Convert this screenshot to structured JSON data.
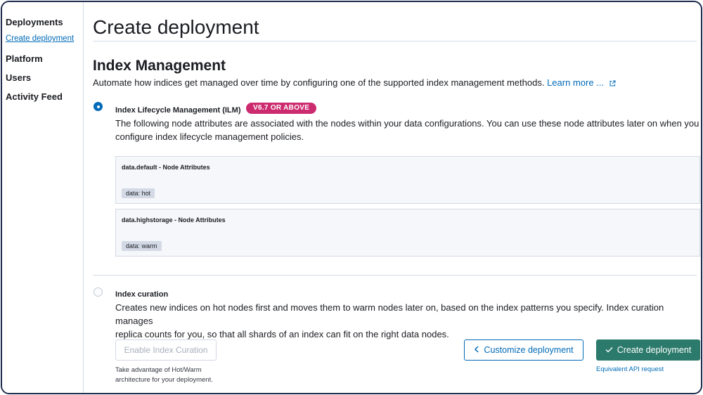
{
  "sidebar": {
    "items": [
      {
        "label": "Deployments"
      },
      {
        "label": "Create deployment"
      },
      {
        "label": "Platform"
      },
      {
        "label": "Users"
      },
      {
        "label": "Activity Feed"
      }
    ]
  },
  "page": {
    "title": "Create deployment"
  },
  "index_management": {
    "title": "Index Management",
    "description": "Automate how indices get managed over time by configuring one of the supported index management methods.",
    "learn_more": "Learn more ...",
    "ilm": {
      "label": "Index Lifecycle Management (ILM)",
      "badge": "V6.7 OR ABOVE",
      "selected": true,
      "description_line1": "The following node attributes are associated with the nodes within your data configurations. You can use these node attributes later on when you",
      "description_line2": "configure index lifecycle management policies.",
      "panels": [
        {
          "title": "data.default - Node Attributes",
          "tag": "data: hot"
        },
        {
          "title": "data.highstorage - Node Attributes",
          "tag": "data: warm"
        }
      ]
    },
    "curation": {
      "label": "Index curation",
      "selected": false,
      "description_line1": "Creates new indices on hot nodes first and moves them to warm nodes later on, based on the index patterns you specify. Index curation manages",
      "description_line2": "replica counts for you, so that all shards of an index can fit on the right data nodes.",
      "enable_button": "Enable Index Curation",
      "help_line1": "Take advantage of Hot/Warm",
      "help_line2": "architecture for your deployment."
    }
  },
  "footer": {
    "customize_button": "Customize deployment",
    "create_button": "Create deployment",
    "api_link": "Equivalent API request"
  },
  "colors": {
    "link": "#006bb8",
    "primary": "#2b7a6b",
    "badge": "#cc2b6f"
  },
  "icons": {
    "external_link": "external-link-icon",
    "chevron": "chevron-left-icon",
    "check": "check-icon"
  }
}
